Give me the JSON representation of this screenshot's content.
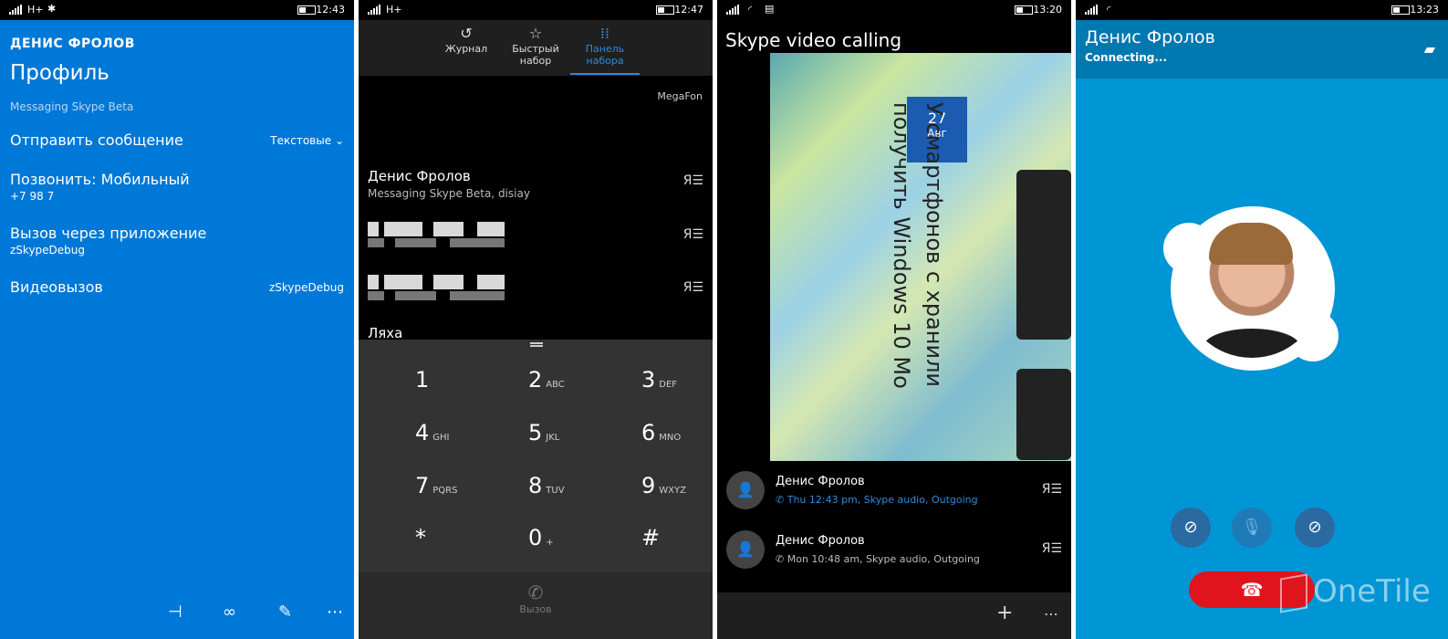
{
  "s1": {
    "status": {
      "network": "H+",
      "time": "12:43"
    },
    "contact_name": "ДЕНИС ФРОЛОВ",
    "title": "Профиль",
    "subtitle": "Messaging Skype Beta",
    "send_message": {
      "label": "Отправить сообщение",
      "option": "Текстовые"
    },
    "call_mobile": {
      "label": "Позвонить: Мобильный",
      "value": "+7 98 7"
    },
    "app_call": {
      "label": "Вызов через приложение",
      "value": "zSkypeDebug"
    },
    "video_call": {
      "label": "Видеовызов",
      "value": "zSkypeDebug"
    }
  },
  "s2": {
    "status": {
      "network": "H+",
      "time": "12:47"
    },
    "tabs": [
      {
        "label": "Журнал",
        "icon": "history-icon"
      },
      {
        "label": "Быстрый набор",
        "icon": "star-icon"
      },
      {
        "label": "Панель набора",
        "icon": "dialpad-icon"
      }
    ],
    "carrier": "MegaFon",
    "contacts": [
      {
        "name": "Денис Фролов",
        "sub": "Messaging Skype Beta, disiay"
      },
      {
        "name": "Ляха",
        "sub": ""
      }
    ],
    "keys": [
      {
        "d": "1",
        "l": ""
      },
      {
        "d": "2",
        "l": "ABC"
      },
      {
        "d": "3",
        "l": "DEF"
      },
      {
        "d": "4",
        "l": "GHI"
      },
      {
        "d": "5",
        "l": "JKL"
      },
      {
        "d": "6",
        "l": "MNO"
      },
      {
        "d": "7",
        "l": "PQRS"
      },
      {
        "d": "8",
        "l": "TUV"
      },
      {
        "d": "9",
        "l": "WXYZ"
      },
      {
        "d": "*",
        "l": ""
      },
      {
        "d": "0",
        "l": "+"
      },
      {
        "d": "#",
        "l": ""
      }
    ],
    "call_label": "Вызов"
  },
  "s3": {
    "status": {
      "time": "13:20"
    },
    "title": "Skype video calling",
    "video": {
      "date_day": "27",
      "date_month": "Авг",
      "line1": "У смартфонов с хранили",
      "line2": "получить Windows 10 Mo"
    },
    "history": [
      {
        "name": "Денис Фролов",
        "detail": "Thu 12:43 pm, Skype audio, Outgoing"
      },
      {
        "name": "Денис Фролов",
        "detail": "Mon 10:48 am, Skype audio, Outgoing"
      }
    ]
  },
  "s4": {
    "status": {
      "time": "13:23"
    },
    "name": "Денис Фролов",
    "call_status": "Connecting...",
    "watermark": "OneTile",
    "colors": {
      "end_call": "#e0141c",
      "background": "#0095d5"
    }
  }
}
